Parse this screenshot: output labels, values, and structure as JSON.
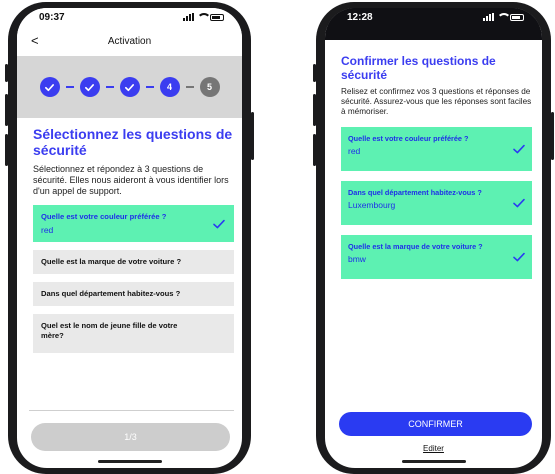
{
  "left": {
    "status_time": "09:37",
    "nav": {
      "back": "<",
      "title": "Activation"
    },
    "stepper": {
      "step4": "4",
      "step5": "5"
    },
    "heading": "Sélectionnez les questions de sécurité",
    "description": "Sélectionnez et répondez à 3 questions de sécurité. Elles nous aideront à vous identifier lors d'un appel de support.",
    "questions": [
      {
        "q": "Quelle est votre couleur préférée ?",
        "a": "red"
      },
      {
        "q": "Quelle est la marque de votre voiture ?"
      },
      {
        "q": "Dans quel département habitez-vous ?"
      },
      {
        "q": "Quel est le nom de jeune fille de votre mère?"
      }
    ],
    "progress_label": "1/3"
  },
  "right": {
    "status_time": "12:28",
    "heading": "Confirmer les questions de sécurité",
    "description": "Relisez et confirmez vos 3 questions et réponses de sécurité. Assurez-vous que les réponses sont faciles à mémoriser.",
    "answers": [
      {
        "q": "Quelle est votre couleur préférée ?",
        "a": "red"
      },
      {
        "q": "Dans quel département habitez-vous ?",
        "a": "Luxembourg"
      },
      {
        "q": "Quelle est la marque de votre voiture ?",
        "a": "bmw"
      }
    ],
    "confirm_label": "CONFIRMER",
    "edit_label": "Editer"
  },
  "colors": {
    "brand_blue": "#3b3df0",
    "selected_green": "#5df1b2",
    "inactive_step": "#767676"
  },
  "icons": [
    "signal-icon",
    "wifi-icon",
    "battery-icon",
    "back-chevron-icon",
    "check-icon"
  ]
}
